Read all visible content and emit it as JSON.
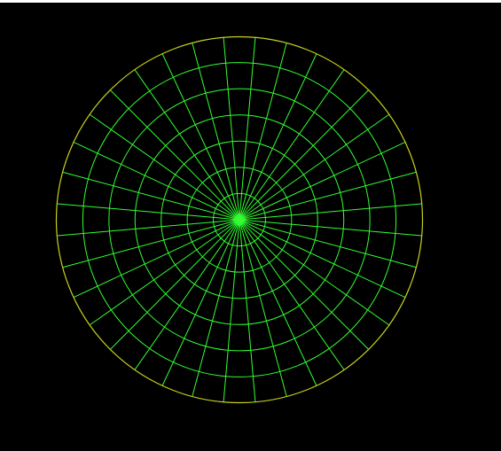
{
  "diagram": {
    "type": "polar-grid",
    "ring_count": 7,
    "radial_line_count": 36,
    "background_color": "#000000",
    "line_color": "#33ff33",
    "outer_edge_color": "#c8d020",
    "frame_color": "#ffffff"
  }
}
